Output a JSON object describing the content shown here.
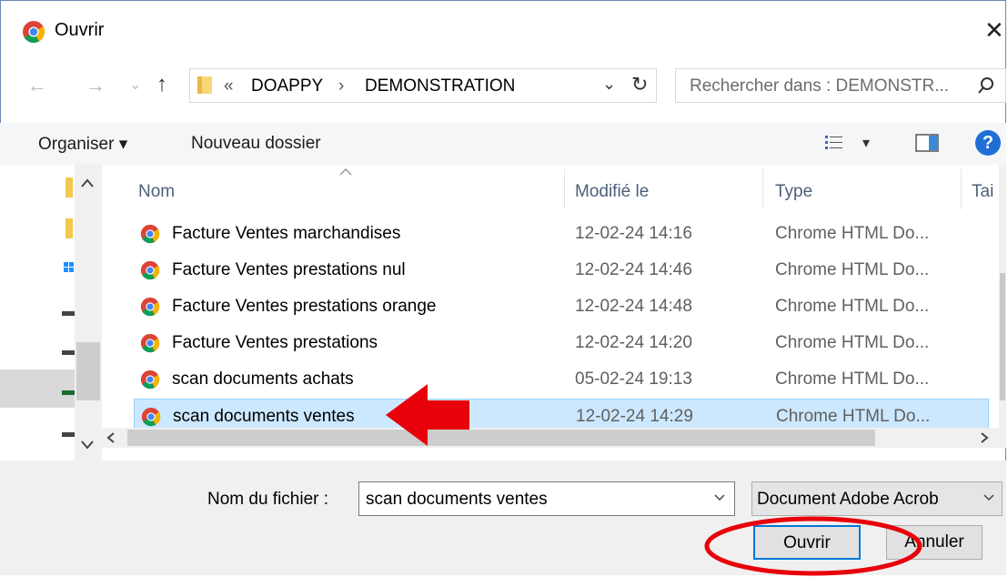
{
  "window": {
    "title": "Ouvrir",
    "close_glyph": "✕"
  },
  "nav": {
    "back_glyph": "←",
    "forward_glyph": "→",
    "recent_glyph": "⌄",
    "up_glyph": "↑",
    "breadcrumb_prefix": "«",
    "breadcrumb": [
      "DOAPPY",
      "DEMONSTRATION"
    ],
    "breadcrumb_sep": "›",
    "dropdown_glyph": "⌄",
    "refresh_glyph": "↻",
    "search_placeholder": "Rechercher dans : DEMONSTR...",
    "search_icon": "search-icon"
  },
  "toolbar": {
    "organize_label": "Organiser ▾",
    "new_folder_label": "Nouveau dossier",
    "view_dropdown_glyph": "▾",
    "help_glyph": "?"
  },
  "columns": {
    "name": "Nom",
    "modified": "Modifié le",
    "type": "Type",
    "size": "Tai"
  },
  "files": [
    {
      "name": "Facture Ventes marchandises",
      "modified": "12-02-24 14:16",
      "type": "Chrome HTML Do...",
      "selected": false
    },
    {
      "name": "Facture Ventes prestations nul",
      "modified": "12-02-24 14:46",
      "type": "Chrome HTML Do...",
      "selected": false
    },
    {
      "name": "Facture Ventes prestations orange",
      "modified": "12-02-24 14:48",
      "type": "Chrome HTML Do...",
      "selected": false
    },
    {
      "name": "Facture Ventes prestations",
      "modified": "12-02-24 14:20",
      "type": "Chrome HTML Do...",
      "selected": false
    },
    {
      "name": "scan documents achats",
      "modified": "05-02-24 19:13",
      "type": "Chrome HTML Do...",
      "selected": false
    },
    {
      "name": "scan documents ventes",
      "modified": "12-02-24 14:29",
      "type": "Chrome HTML Do...",
      "selected": true
    }
  ],
  "bottom": {
    "filename_label": "Nom du fichier :",
    "filename_value": "scan documents ventes",
    "filetype_value": "Document Adobe Acrob",
    "open_label": "Ouvrir",
    "cancel_label": "Annuler"
  },
  "colors": {
    "selection_bg": "#cce8ff",
    "accent": "#0078d7",
    "annotation_red": "#e8000b",
    "help_blue": "#1f6fd6"
  }
}
